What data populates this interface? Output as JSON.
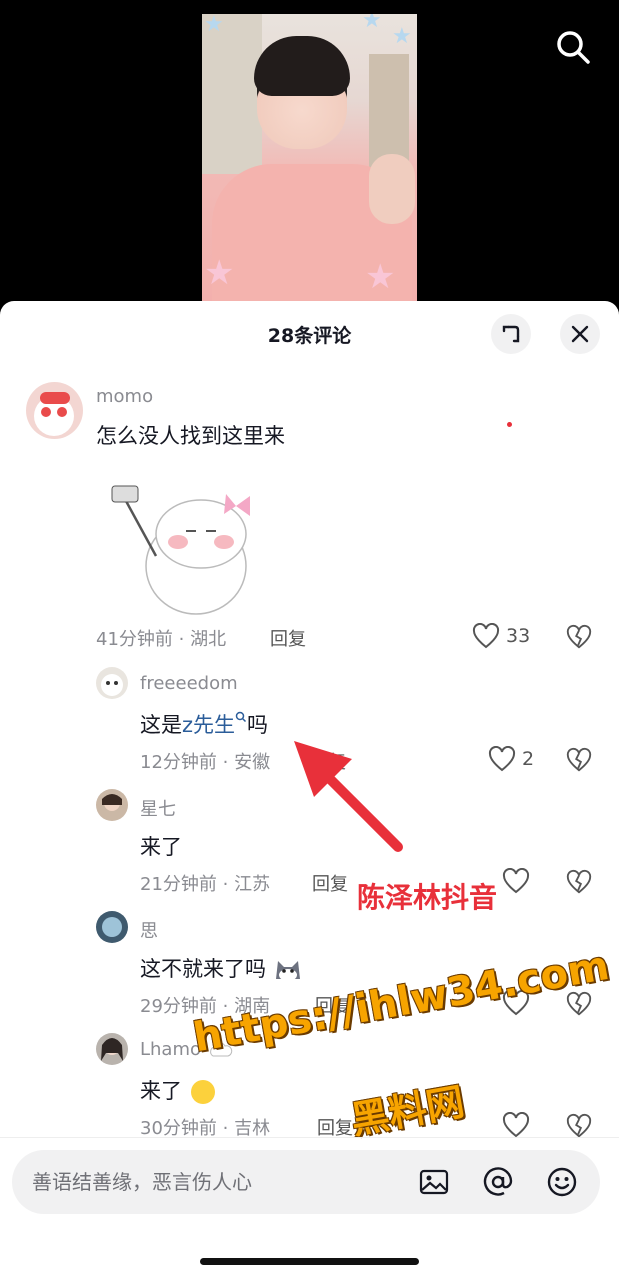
{
  "header": {
    "comment_count_title": "28条评论"
  },
  "icons": {
    "search": "search-icon",
    "expand": "expand-icon",
    "close": "close-icon",
    "like": "heart-icon",
    "dislike": "broken-heart-icon",
    "image": "image-icon",
    "mention": "at-icon",
    "emoji": "emoji-icon"
  },
  "comments": [
    {
      "username": "momo",
      "text": "怎么没人找到这里来",
      "meta": "41分钟前 · 湖北",
      "reply": "回复",
      "likes": "33"
    },
    {
      "username": "freeeedom",
      "text_before": "这是",
      "mention": "z先生",
      "text_after": "吗",
      "meta": "12分钟前 · 安徽",
      "reply": "回复",
      "likes": "2"
    },
    {
      "username": "星七",
      "text": "来了",
      "meta": "21分钟前 · 江苏",
      "reply": "回复",
      "likes": ""
    },
    {
      "username": "思",
      "text": "这不就来了吗",
      "meta": "29分钟前 · 湖南",
      "reply": "回复",
      "likes": ""
    },
    {
      "username": "Lhamo",
      "text": "来了",
      "meta": "30分钟前 · 吉林",
      "reply": "回复",
      "likes": ""
    }
  ],
  "overlays": {
    "red_caption": "陈泽林抖音",
    "watermark_url": "https://ihlw34.com",
    "watermark_cn": "黑料网"
  },
  "input": {
    "placeholder": "善语结善缘，恶言伤人心"
  },
  "colors": {
    "accent_red": "#e8303a",
    "watermark": "#f7a400",
    "mention": "#2b5d9a",
    "text": "#161823",
    "muted": "#8a8b91"
  }
}
